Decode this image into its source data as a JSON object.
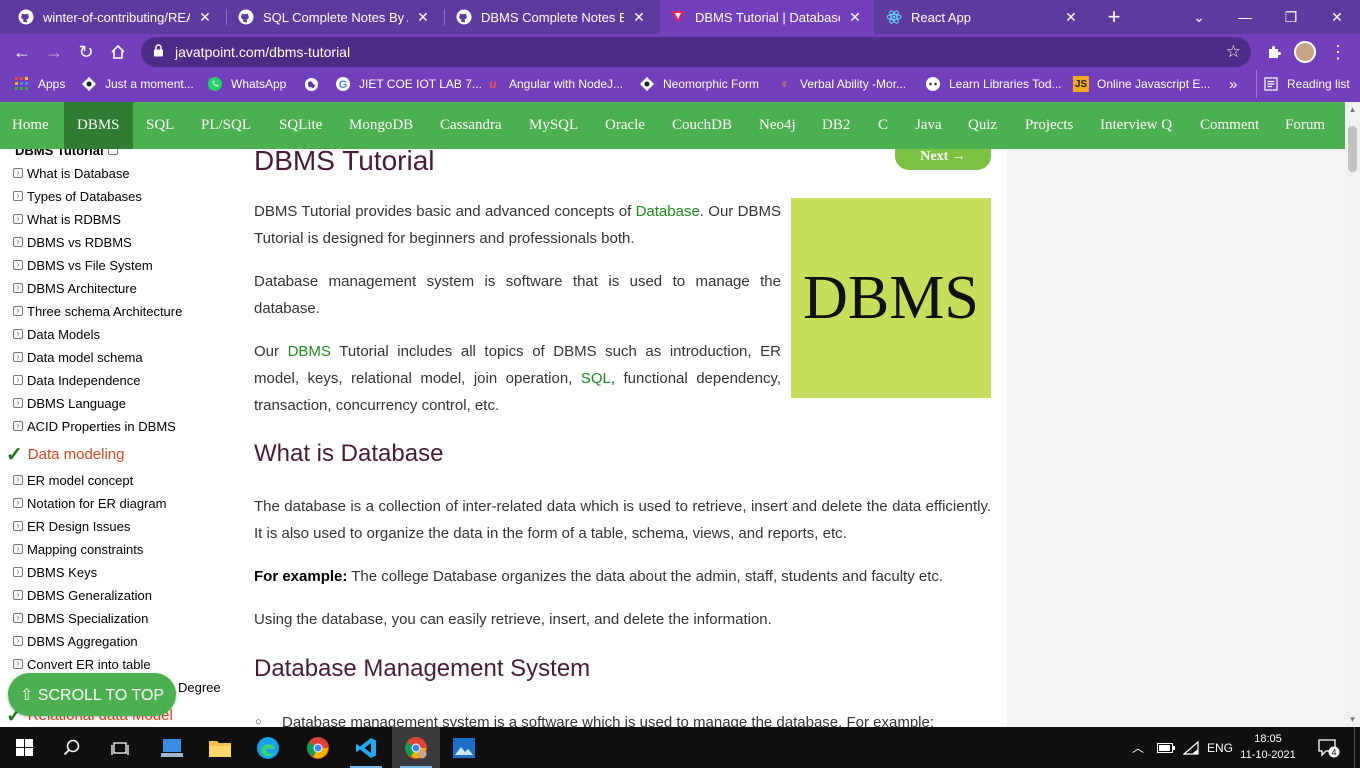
{
  "browser": {
    "tabs": [
      {
        "title": "winter-of-contributing/REAC",
        "icon": "github-icon"
      },
      {
        "title": "SQL Complete Notes By Abh",
        "icon": "github-icon"
      },
      {
        "title": "DBMS Complete Notes By Ab",
        "icon": "github-icon"
      },
      {
        "title": "DBMS Tutorial | Database Ma",
        "icon": "javatpoint-icon"
      },
      {
        "title": "React App",
        "icon": "react-icon"
      }
    ],
    "url": "javatpoint.com/dbms-tutorial",
    "bookmarks": [
      {
        "label": "Apps"
      },
      {
        "label": "Just a moment..."
      },
      {
        "label": "WhatsApp"
      },
      {
        "label": ""
      },
      {
        "label": "JIET COE IOT LAB 7..."
      },
      {
        "label": "Angular with NodeJ..."
      },
      {
        "label": "Neomorphic Form"
      },
      {
        "label": "Verbal Ability -Mor..."
      },
      {
        "label": "Learn Libraries Tod..."
      },
      {
        "label": "Online Javascript E..."
      }
    ],
    "more_bookmarks": "»",
    "reading_list": "Reading list"
  },
  "sitenav": {
    "items": [
      "Home",
      "DBMS",
      "SQL",
      "PL/SQL",
      "SQLite",
      "MongoDB",
      "Cassandra",
      "MySQL",
      "Oracle",
      "CouchDB",
      "Neo4j",
      "DB2",
      "C",
      "Java",
      "Quiz",
      "Projects",
      "Interview Q",
      "Comment",
      "Forum"
    ],
    "active": "DBMS"
  },
  "sidebar": {
    "top_partial": "DBMS Tutorial",
    "items_a": [
      "What is Database",
      "Types of Databases",
      "What is RDBMS",
      "DBMS vs RDBMS",
      "DBMS vs File System",
      "DBMS Architecture",
      "Three schema Architecture",
      "Data Models",
      "Data model schema",
      "Data Independence",
      "DBMS Language",
      "ACID Properties in DBMS"
    ],
    "heading_1": "Data modeling",
    "items_b": [
      "ER model concept",
      "Notation for ER diagram",
      "ER Design Issues",
      "Mapping constraints",
      "DBMS Keys",
      "DBMS Generalization",
      "DBMS Specialization",
      "DBMS Aggregation",
      "Convert ER into table"
    ],
    "partial_item": "Degree",
    "heading_2": "Relational data Model",
    "scroll_top": "⇧ SCROLL TO TOP"
  },
  "content": {
    "title": "DBMS Tutorial",
    "next": "Next →",
    "p1_pre": "DBMS Tutorial provides basic and advanced concepts of ",
    "p1_link": "Database",
    "p1_post": ". Our DBMS Tutorial is designed for beginners and professionals both.",
    "p2": "Database management system is software that is used to manage the database.",
    "p3_pre": "Our ",
    "p3_link1": "DBMS",
    "p3_mid": " Tutorial includes all topics of DBMS such as introduction, ER model, keys, relational model, join operation, ",
    "p3_link2": "SQL",
    "p3_post": ", functional dependency, transaction, concurrency control, etc.",
    "image_text": "DBMS",
    "h2_1": "What is Database",
    "p4": "The database is a collection of inter-related data which is used to retrieve, insert and delete the data efficiently. It is also used to organize the data in the form of a table, schema, views, and reports, etc.",
    "p5_bold": "For example:",
    "p5_rest": " The college Database organizes the data about the admin, staff, students and faculty etc.",
    "p6": "Using the database, you can easily retrieve, insert, and delete the information.",
    "h2_2": "Database Management System",
    "bullet1": "Database management system is a software which is used to manage the database. For example:"
  },
  "taskbar": {
    "language": "ENG",
    "time": "18:05",
    "date": "11-10-2021",
    "notifications": "4"
  },
  "colors": {
    "chrome_frame": "#5e3a9e",
    "chrome_active": "#7340bd",
    "site_green": "#4caf50",
    "site_green_active": "#2e7d32",
    "heading": "#4a1a3a",
    "link": "#1c8c1c",
    "image_bg": "#c5de5b"
  }
}
